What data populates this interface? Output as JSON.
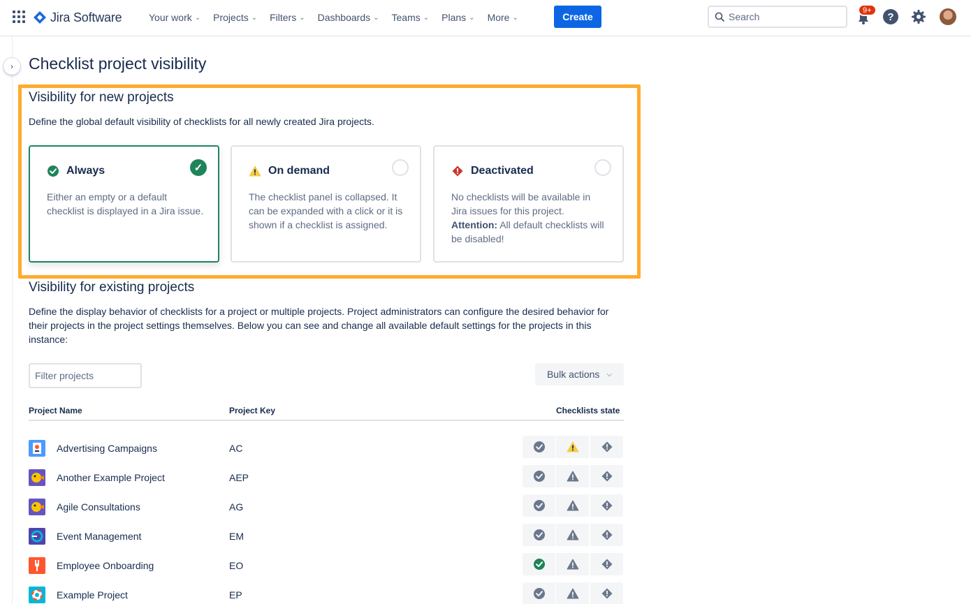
{
  "nav": {
    "app_name": "Jira Software",
    "items": [
      {
        "label": "Your work"
      },
      {
        "label": "Projects"
      },
      {
        "label": "Filters"
      },
      {
        "label": "Dashboards"
      },
      {
        "label": "Teams"
      },
      {
        "label": "Plans"
      },
      {
        "label": "More"
      }
    ],
    "create_label": "Create",
    "search_placeholder": "Search",
    "notification_badge": "9+"
  },
  "page": {
    "title": "Checklist project visibility",
    "new_projects": {
      "heading": "Visibility for new projects",
      "description": "Define the global default visibility of checklists for all newly created Jira projects.",
      "options": [
        {
          "title": "Always",
          "body": "Either an empty or a default checklist is displayed in a Jira issue.",
          "selected": true
        },
        {
          "title": "On demand",
          "body": "The checklist panel is collapsed. It can be expanded with a click or it is shown if a checklist is assigned.",
          "selected": false
        },
        {
          "title": "Deactivated",
          "body": "No checklists will be available in Jira issues for this project.",
          "attention_label": "Attention:",
          "attention_body": "All default checklists will be disabled!",
          "selected": false
        }
      ]
    },
    "existing_projects": {
      "heading": "Visibility for existing projects",
      "description": "Define the display behavior of checklists for a project or multiple projects. Project administrators can configure the desired behavior for their projects in the project settings themselves. Below you can see and change all available default settings for the projects in this instance:",
      "filter_placeholder": "Filter projects",
      "bulk_actions_label": "Bulk actions",
      "columns": {
        "name": "Project Name",
        "key": "Project Key",
        "state": "Checklists state"
      },
      "projects": [
        {
          "name": "Advertising Campaigns",
          "key": "AC",
          "state": "on-demand"
        },
        {
          "name": "Another Example Project",
          "key": "AEP",
          "state": "none"
        },
        {
          "name": "Agile Consultations",
          "key": "AG",
          "state": "none"
        },
        {
          "name": "Event Management",
          "key": "EM",
          "state": "none"
        },
        {
          "name": "Employee Onboarding",
          "key": "EO",
          "state": "always"
        },
        {
          "name": "Example Project",
          "key": "EP",
          "state": "none"
        }
      ]
    }
  },
  "colors": {
    "brand_blue": "#0C66E4",
    "highlight_orange": "#FFAB2E",
    "success_green": "#1F845A",
    "warning_yellow": "#F5CD47",
    "danger_red": "#C9372C",
    "neutral_icon": "#6B778C"
  }
}
